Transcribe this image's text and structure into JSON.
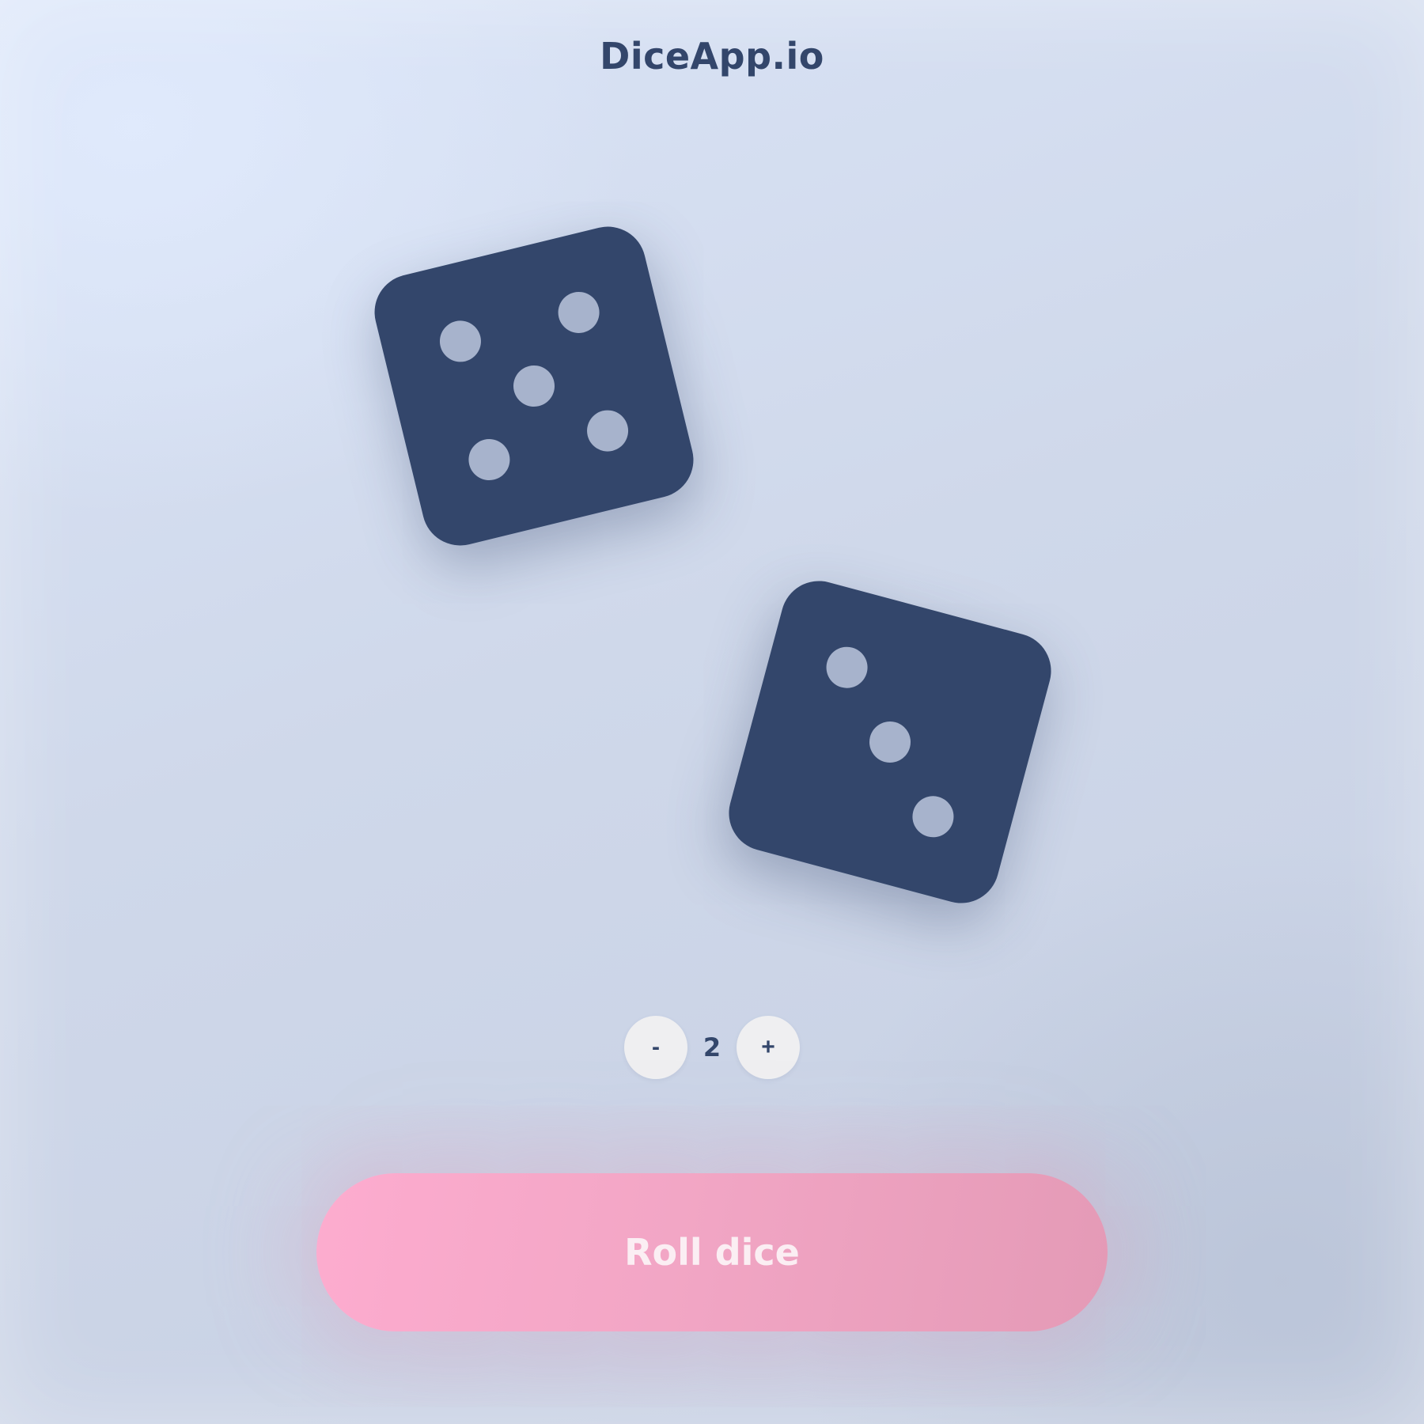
{
  "app": {
    "title": "DiceApp.io"
  },
  "dice": [
    {
      "value": 5
    },
    {
      "value": 3
    }
  ],
  "counter": {
    "decrement_label": "-",
    "count": "2",
    "increment_label": "+"
  },
  "roll_button": {
    "label": "Roll dice"
  },
  "colors": {
    "die": "#33466b",
    "pip": "#a7b3cc",
    "text": "#33466b",
    "button_pink_start": "#fdaccf",
    "button_pink_end": "#e49ab6"
  }
}
